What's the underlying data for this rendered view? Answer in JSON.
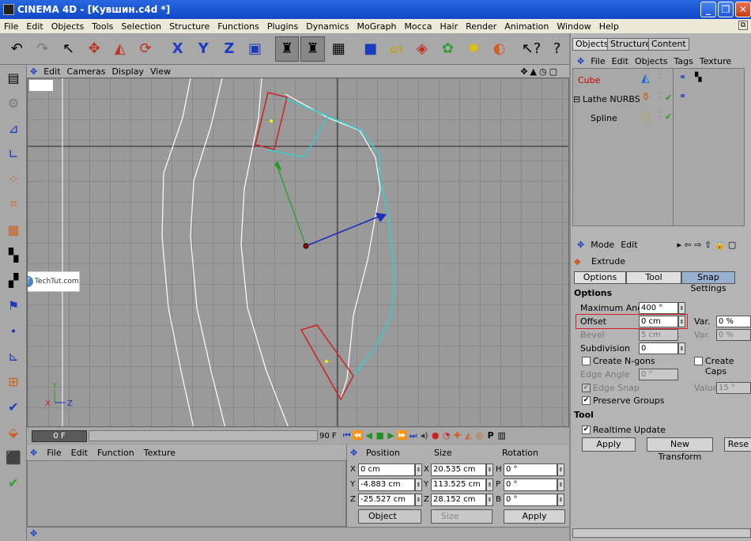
{
  "window": {
    "title": "CINEMA 4D - [Кувшин.c4d *]",
    "min_icon": "minimize-icon",
    "max_icon": "maximize-icon",
    "close_icon": "close-icon"
  },
  "menu": [
    "File",
    "Edit",
    "Objects",
    "Tools",
    "Selection",
    "Structure",
    "Functions",
    "Plugins",
    "Dynamics",
    "MoGraph",
    "Mocca",
    "Hair",
    "Render",
    "Animation",
    "Window",
    "Help"
  ],
  "viewport": {
    "menu": [
      "Edit",
      "Cameras",
      "Display",
      "View"
    ],
    "watermark": "TechTut.com",
    "axis_y": "Y",
    "axis_x": "X",
    "axis_z": "Z"
  },
  "timeline": {
    "current_frame": "0 F",
    "end_frame": "90 F"
  },
  "materials": {
    "menu": [
      "File",
      "Edit",
      "Function",
      "Texture"
    ]
  },
  "coordinates": {
    "headers": {
      "position": "Position",
      "size": "Size",
      "rotation": "Rotation"
    },
    "rows": [
      {
        "pl": "X",
        "pv": "0 cm",
        "sl": "X",
        "sv": "20.535 cm",
        "rl": "H",
        "rv": "0 °"
      },
      {
        "pl": "Y",
        "pv": "-4.883 cm",
        "sl": "Y",
        "sv": "113.525 cm",
        "rl": "P",
        "rv": "0 °"
      },
      {
        "pl": "Z",
        "pv": "-25.527 cm",
        "sl": "Z",
        "sv": "28.152 cm",
        "rl": "B",
        "rv": "0 °"
      }
    ],
    "mode_select": "Object",
    "size_select": "Size",
    "apply": "Apply"
  },
  "objects_panel": {
    "tabs": [
      "Objects",
      "Structure",
      "Content"
    ],
    "menu": [
      "File",
      "Edit",
      "Objects",
      "Tags",
      "Texture"
    ],
    "items": [
      {
        "name": "Cube",
        "color": "#cc0000"
      },
      {
        "name": "Lathe NURBS",
        "color": "#000000"
      },
      {
        "name": "Spline",
        "color": "#000000"
      }
    ]
  },
  "attributes": {
    "menu": [
      "Mode",
      "Edit"
    ],
    "tool_name": "Extrude",
    "tabs": [
      "Options",
      "Tool",
      "Snap Settings"
    ],
    "options_title": "Options",
    "max_angle_label": "Maximum Angle",
    "max_angle_value": "400 °",
    "offset_label": "Offset",
    "offset_value": "0 cm",
    "var_label": "Var.",
    "offset_var": "0 %",
    "bevel_label": "Bevel",
    "bevel_value": "5 cm",
    "bevel_var": "0 %",
    "subdivision_label": "Subdivision",
    "subdivision_value": "0",
    "create_ngons": "Create N-gons",
    "create_caps": "Create Caps",
    "edge_angle_label": "Edge Angle",
    "edge_angle_value": "0 °",
    "edge_snap": "Edge Snap",
    "value_label": "Value",
    "value_value": "15 °",
    "preserve_groups": "Preserve Groups",
    "tool_title": "Tool",
    "realtime_update": "Realtime Update",
    "apply": "Apply",
    "new_transform": "New Transform",
    "reset": "Rese"
  }
}
